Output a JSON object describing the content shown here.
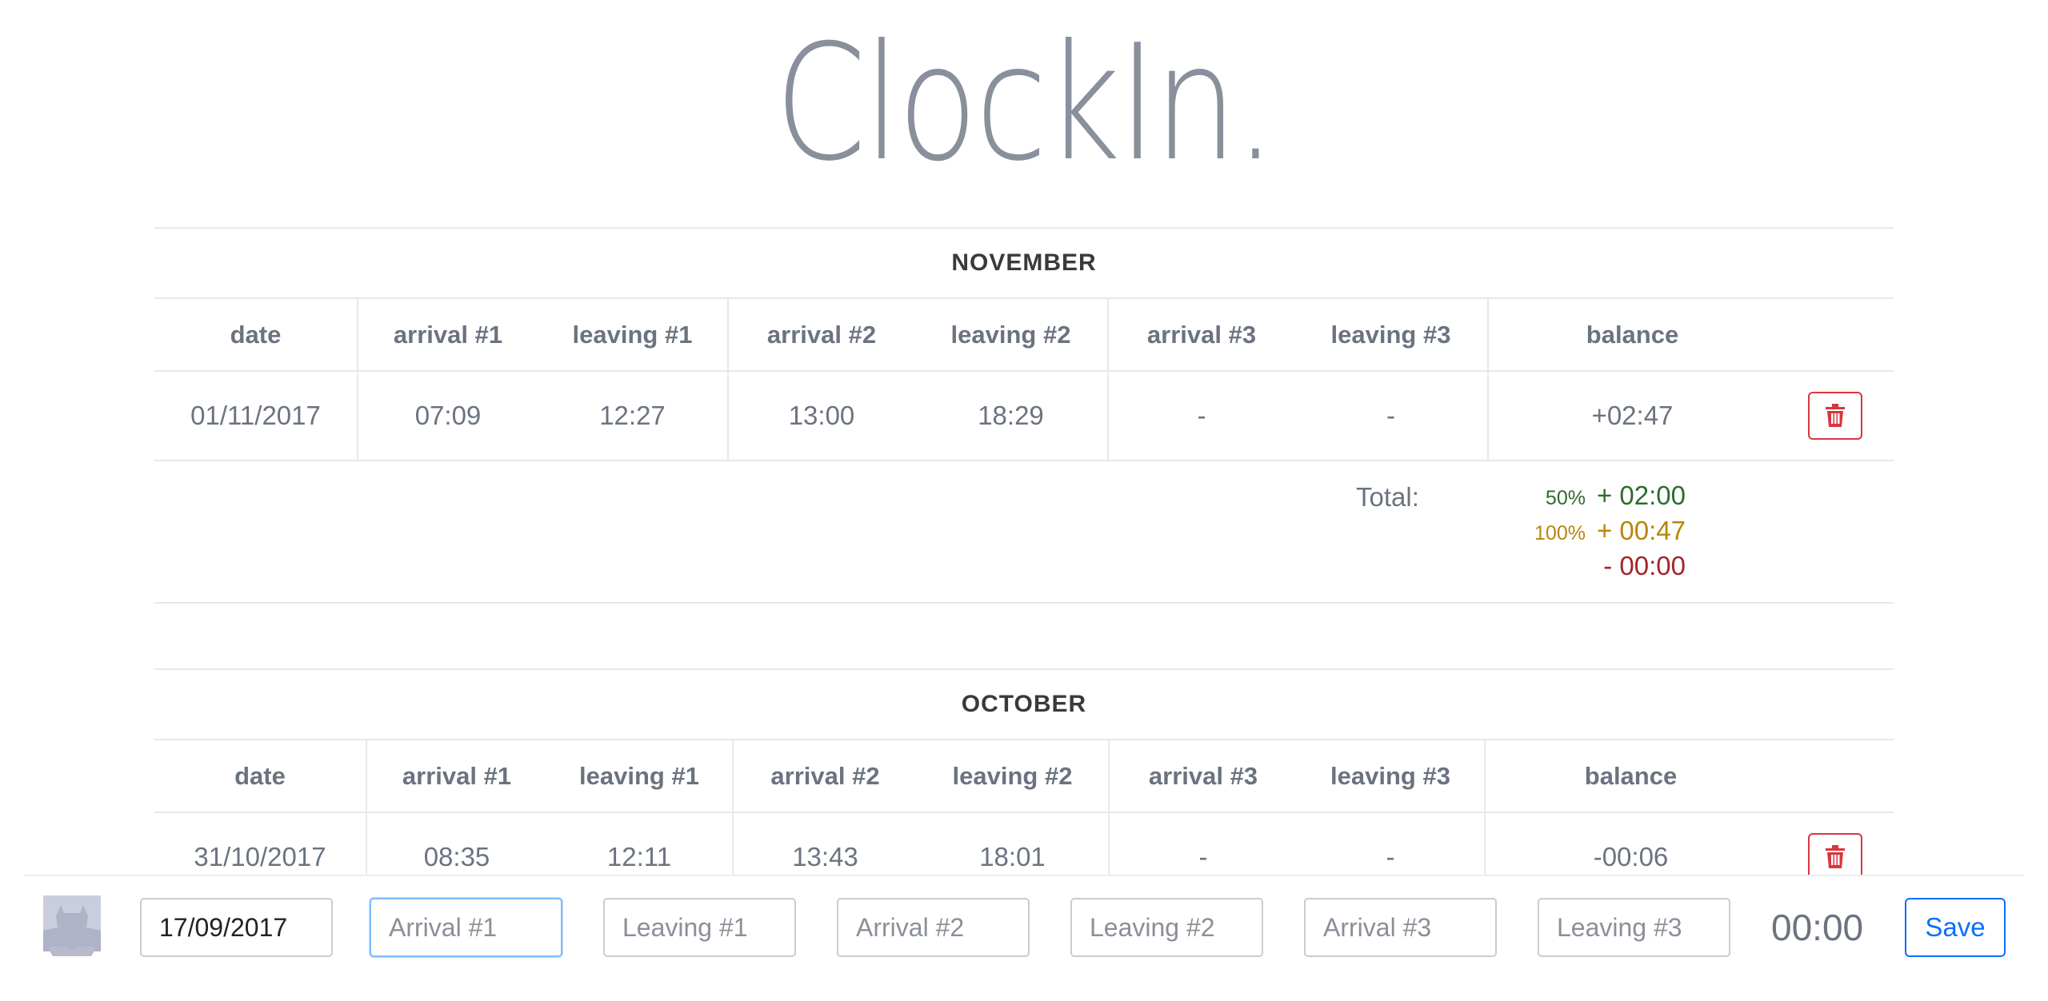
{
  "app": {
    "title": "ClockIn."
  },
  "columns": [
    "date",
    "arrival #1",
    "leaving #1",
    "arrival #2",
    "leaving #2",
    "arrival #3",
    "leaving #3",
    "balance"
  ],
  "months": [
    {
      "name": "NOVEMBER",
      "rows": [
        {
          "date": "01/11/2017",
          "arrival1": "07:09",
          "leaving1": "12:27",
          "arrival2": "13:00",
          "leaving2": "18:29",
          "arrival3": "-",
          "leaving3": "-",
          "balance": "+02:47"
        }
      ],
      "total": {
        "label": "Total:",
        "pct50": "50%",
        "value50": "+ 02:00",
        "pct100": "100%",
        "value100": "+ 00:47",
        "negative": "- 00:00"
      }
    },
    {
      "name": "OCTOBER",
      "rows": [
        {
          "date": "31/10/2017",
          "arrival1": "08:35",
          "leaving1": "12:11",
          "arrival2": "13:43",
          "leaving2": "18:01",
          "arrival3": "-",
          "leaving3": "-",
          "balance": "-00:06"
        }
      ]
    }
  ],
  "entry_form": {
    "date_value": "17/09/2017",
    "arrival1_placeholder": "Arrival #1",
    "leaving1_placeholder": "Leaving #1",
    "arrival2_placeholder": "Arrival #2",
    "leaving2_placeholder": "Leaving #2",
    "arrival3_placeholder": "Arrival #3",
    "leaving3_placeholder": "Leaving #3",
    "timer": "00:00",
    "save_label": "Save"
  },
  "colors": {
    "positive": "#2e6b2e",
    "warning": "#b8860b",
    "negative": "#a3262a",
    "danger": "#d9363e",
    "primary": "#0d6efd"
  },
  "icons": {
    "delete": "trash-icon",
    "avatar": "batman-avatar-icon"
  }
}
